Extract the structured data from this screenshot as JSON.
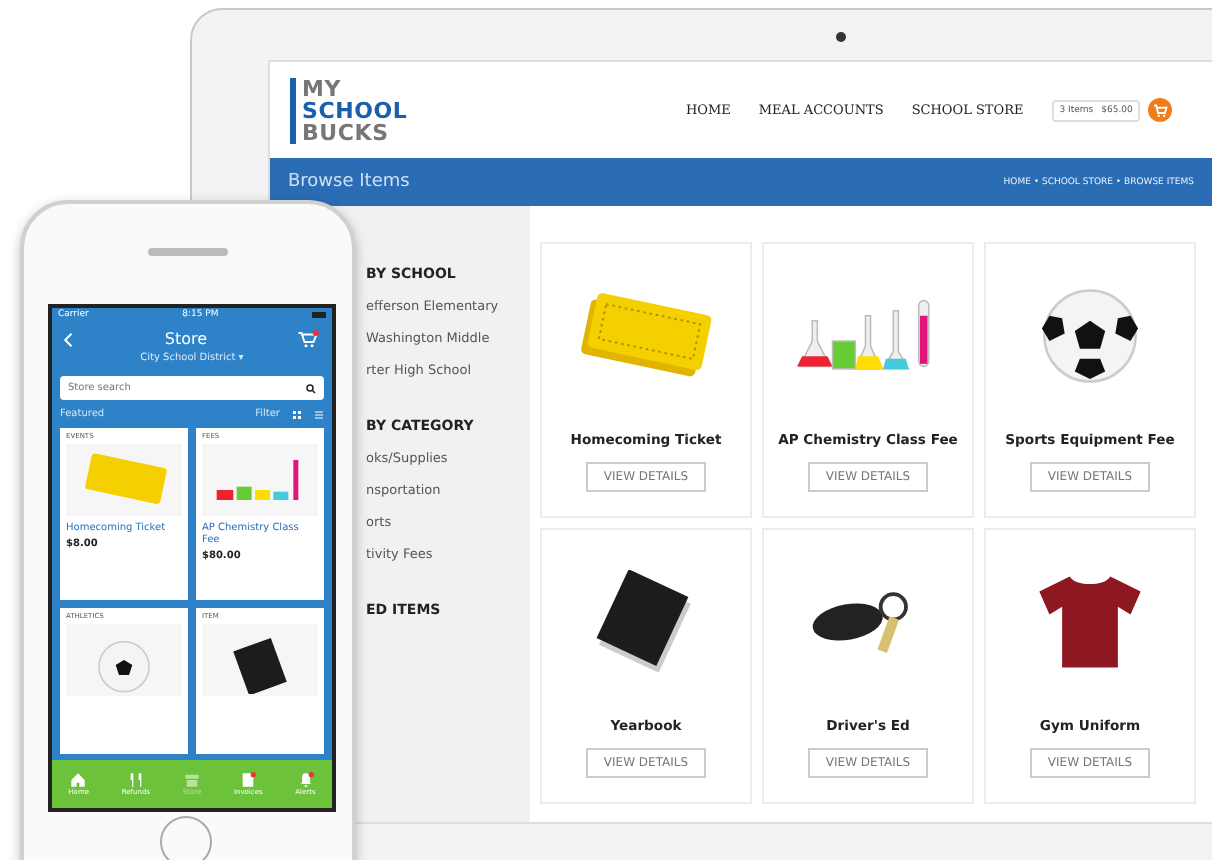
{
  "laptop": {
    "logo": [
      "MY",
      "SCHOOL",
      "BUCKS"
    ],
    "nav": [
      "HOME",
      "MEAL ACCOUNTS",
      "SCHOOL STORE"
    ],
    "cart": {
      "items": "3 Items",
      "total": "$65.00"
    },
    "page_title": "Browse Items",
    "breadcrumb": "HOME • SCHOOL STORE • BROWSE ITEMS",
    "sidebar": [
      {
        "heading": "BY SCHOOL",
        "items": [
          "efferson Elementary",
          "Washington Middle",
          "rter High School"
        ]
      },
      {
        "heading": "BY CATEGORY",
        "items": [
          "oks/Supplies",
          "nsportation",
          "orts",
          "tivity Fees"
        ]
      },
      {
        "heading": "ED ITEMS"
      }
    ],
    "products": [
      {
        "name": "Homecoming Ticket",
        "button": "VIEW DETAILS"
      },
      {
        "name": "AP Chemistry Class Fee",
        "button": "VIEW DETAILS"
      },
      {
        "name": "Sports Equipment Fee",
        "button": "VIEW DETAILS"
      },
      {
        "name": "Yearbook",
        "button": "VIEW DETAILS"
      },
      {
        "name": "Driver's Ed",
        "button": "VIEW DETAILS"
      },
      {
        "name": "Gym Uniform",
        "button": "VIEW DETAILS"
      }
    ]
  },
  "phone": {
    "carrier": "Carrier",
    "time": "8:15 PM",
    "title": "Store",
    "district": "City School District ▾",
    "search": {
      "placeholder": "Store search"
    },
    "featured": "Featured",
    "filter": "Filter",
    "cards": [
      {
        "label": "EVENTS",
        "name": "Homecoming Ticket",
        "price": "$8.00"
      },
      {
        "label": "FEES",
        "name": "AP Chemistry Class Fee",
        "price": "$80.00"
      },
      {
        "label": "ATHLETICS"
      },
      {
        "label": "ITEM"
      }
    ],
    "tabs": [
      {
        "label": "Home",
        "selected": false,
        "badge": false
      },
      {
        "label": "Refunds",
        "selected": false,
        "badge": false
      },
      {
        "label": "Store",
        "selected": true,
        "badge": false
      },
      {
        "label": "Invoices",
        "selected": false,
        "badge": true
      },
      {
        "label": "Alerts",
        "selected": false,
        "badge": true
      }
    ]
  }
}
